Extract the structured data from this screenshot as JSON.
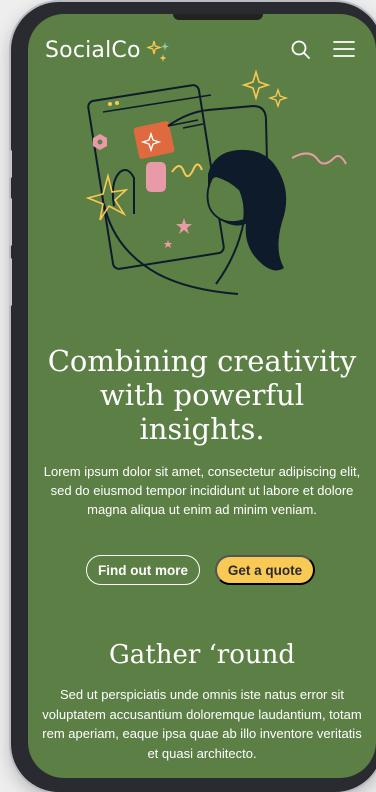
{
  "header": {
    "logo_text": "SocialCo",
    "icons": [
      "sparkle-icon",
      "search-icon",
      "hamburger-menu-icon"
    ]
  },
  "hero": {
    "title": "Combining creativity with powerful insights.",
    "text": "Lorem ipsum dolor sit amet, consectetur adipiscing elit, sed do eiusmod tempor incididunt ut labore et dolore magna aliqua ut enim ad minim veniam.",
    "primary_button": "Find out more",
    "secondary_button": "Get a quote"
  },
  "section": {
    "title": "Gather ‘round",
    "text": "Sed ut perspiciatis unde omnis iste natus error sit voluptatem accusantium doloremque laudantium, totam rem aperiam, eaque ipsa quae ab illo inventore veritatis et quasi architecto."
  },
  "colors": {
    "background": "#5c7f45",
    "accent": "#f8c954",
    "illustration_orange": "#e06a3f",
    "illustration_pink": "#e89aa6",
    "illustration_outline": "#0d1b2b"
  }
}
